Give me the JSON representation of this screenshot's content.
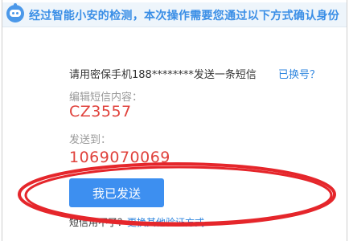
{
  "header": {
    "text": "经过智能小安的检测，本次操作需要您通过以下方式确认身份",
    "icon": "robot-icon"
  },
  "verify": {
    "prompt": "请用密保手机188********发送一条短信",
    "change_link": "已换号？",
    "content_label": "编辑短信内容：",
    "content_value": "CZ3557",
    "to_label": "发送到：",
    "to_value": "1069070069"
  },
  "actions": {
    "sent_button": "我已发送"
  },
  "footer": {
    "question": "短信用不了？",
    "other_methods_link": "更换其他验证方式"
  },
  "colors": {
    "accent": "#3d8ff0",
    "link": "#2f86df",
    "highlight": "#e0423c",
    "annotation": "#e5262b"
  }
}
